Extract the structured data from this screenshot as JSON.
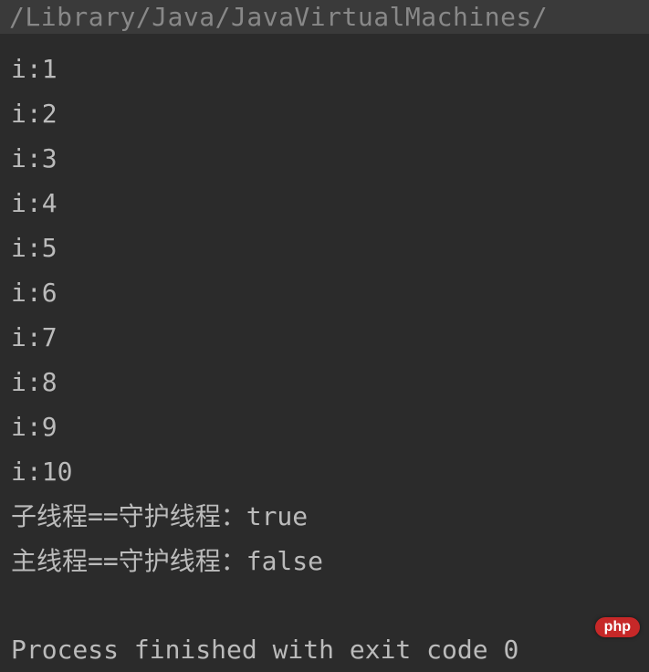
{
  "path": "/Library/Java/JavaVirtualMachines/",
  "lines": [
    "i:1",
    "i:2",
    "i:3",
    "i:4",
    "i:5",
    "i:6",
    "i:7",
    "i:8",
    "i:9",
    "i:10",
    "子线程==守护线程：true",
    "主线程==守护线程：false"
  ],
  "exit_message": "Process finished with exit code 0",
  "watermark": "php"
}
